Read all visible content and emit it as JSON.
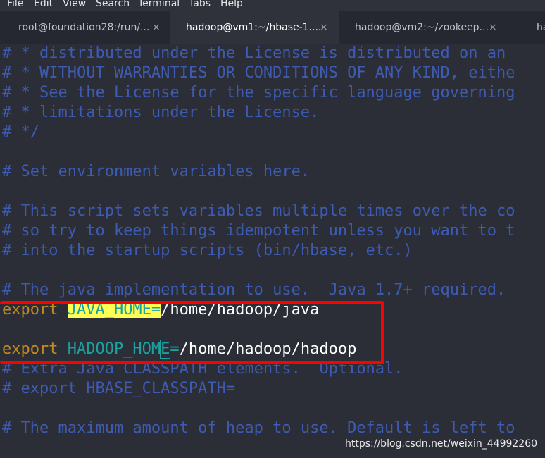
{
  "menu": [
    "File",
    "Edit",
    "View",
    "Search",
    "Terminal",
    "Tabs",
    "Help"
  ],
  "tabs": [
    {
      "label": "root@foundation28:/run/...",
      "close": "×"
    },
    {
      "label": "hadoop@vm1:~/hbase-1....",
      "close": "×"
    },
    {
      "label": "hadoop@vm2:~/zookeep...",
      "close": "×"
    },
    {
      "label": "ha"
    }
  ],
  "lines": {
    "l1": "# * distributed under the License is distributed on an",
    "l2": "# * WITHOUT WARRANTIES OR CONDITIONS OF ANY KIND, eithe",
    "l3": "# * See the License for the specific language governing",
    "l4": "# * limitations under the License.",
    "l5": "# */",
    "l6": "# Set environment variables here.",
    "l7": "# This script sets variables multiple times over the co",
    "l8": "# so try to keep things idempotent unless you want to t",
    "l9": "# into the startup scripts (bin/hbase, etc.)",
    "l10": "# The java implementation to use.  Java 1.7+ required.",
    "l11_kw": "export ",
    "l11_var": "JAVA_HOME=",
    "l11_val": "/home/hadoop/java",
    "l12_kw": "export ",
    "l12_var": "HADOOP_HOM",
    "l12_cur": "E",
    "l12_eq": "=",
    "l12_val": "/home/hadoop/hadoop",
    "l13": "# Extra Java CLASSPATH elements.  Optional.",
    "l14": "# export HBASE_CLASSPATH=",
    "l15": "# The maximum amount of heap to use. Default is left to"
  },
  "watermark": "https://blog.csdn.net/weixin_44992260",
  "colors": {
    "comment": "#3d5bb3",
    "keyword": "#c18a1e",
    "variable": "#1ba2a0",
    "highlight": "#ffff55",
    "annotation_box": "#ff0000"
  }
}
